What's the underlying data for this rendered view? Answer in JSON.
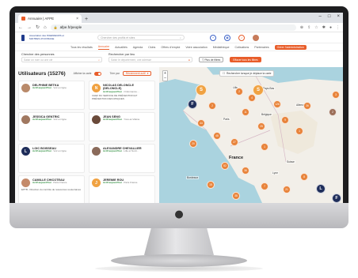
{
  "browser": {
    "tab_title": "Annuaire | AFPE",
    "tab_close": "×",
    "new_tab": "+",
    "win_min": "–",
    "win_max": "□",
    "win_close": "×",
    "url": "afpe.fr/people",
    "lock": "🔒"
  },
  "site": {
    "logo_text": "Association des INGENIEURS et MAITRES d'OUVRAGE",
    "search_placeholder": "Chercher des profils et sites",
    "nav": [
      "Tous les résultats",
      "Annuaire",
      "Actualités",
      "Agenda",
      "Clubs",
      "Offres d'emploi",
      "Votre association",
      "Médiathèque",
      "Cotisations",
      "Partenaires",
      "Gérer l'administration"
    ],
    "active_nav": "Annuaire",
    "admin_nav": "Gérer l'administration"
  },
  "filters": {
    "people_label": "Chercher des personnes",
    "people_placeholder": "Saisir un nom ou une clé",
    "place_label": "Rechercher par lieu",
    "place_placeholder": "Saisir le département, une adresse",
    "more_filters": "Plus de filtres",
    "clear": "Effacer tous les filtres"
  },
  "list": {
    "title": "Utilisateurs (15276)",
    "map_toggle_label": "Afficher la carte",
    "sort_label": "Trier par",
    "sort_value": "Récemment actif",
    "cards": [
      {
        "name": "DELPHINE BETKA",
        "role_status": "Actif aujourd'hui",
        "role_rest": "· Voir en ligne",
        "extra": "",
        "initial": "",
        "color": "#b98a6a"
      },
      {
        "name": "NICOLAS DELONCLE (DELONCLE)",
        "role_status": "Actif aujourd'hui",
        "role_rest": "· Ordonnance…",
        "extra": "CHEF DU SERVICE DE PRÉVENTION ET PRÉVENTION DES RISQUES",
        "initial": "N",
        "color": "#f0a242"
      },
      {
        "name": "JESSICA GENTRIC",
        "role_status": "Actif aujourd'hui",
        "role_rest": "· Voir en ligne",
        "extra": "",
        "initial": "",
        "color": "#a07860"
      },
      {
        "name": "JEAN SENG",
        "role_status": "Actif aujourd'hui",
        "role_rest": "· Yves-et-Vilaine",
        "extra": "",
        "initial": "",
        "color": "#6a4a3a"
      },
      {
        "name": "LOIC BOISSEAU",
        "role_status": "Actif aujourd'hui",
        "role_rest": "· Voir en ligne",
        "extra": "",
        "initial": "L",
        "color": "#1e2d5a"
      },
      {
        "name": "ALEXANDRE CHEVALLIER",
        "role_status": "Actif aujourd'hui",
        "role_rest": "· Lille et Nord…",
        "extra": "",
        "initial": "",
        "color": "#8a6a5a"
      },
      {
        "name": "CAMILLE CHICOTEAU",
        "role_status": "Actif aujourd'hui",
        "role_rest": "· Paris France",
        "extra": "EPTB - Direction du contrôle de ressources souterraines",
        "initial": "",
        "color": "#c48a6a"
      },
      {
        "name": "JEREMIE ROU",
        "role_status": "Actif aujourd'hui",
        "role_rest": "· Paris France",
        "extra": "",
        "initial": "J",
        "color": "#f0a242"
      }
    ]
  },
  "map": {
    "search_toggle": "Rechercher lorsque je déplace la carte",
    "zoom_in": "+",
    "zoom_out": "–",
    "countries": [
      "France",
      "Belgique",
      "Suisse",
      "Allemagne"
    ],
    "cities": [
      "Pays-Bas",
      "Paris",
      "Lyon",
      "Bordeaux",
      "Lille"
    ],
    "clusters": [
      "S",
      "S",
      "F",
      "3",
      "2",
      "4",
      "2",
      "126",
      "36",
      "2",
      "44",
      "11",
      "25",
      "9",
      "1",
      "20",
      "48",
      "27",
      "1",
      "52",
      "36",
      "15",
      "7",
      "38",
      "21",
      "8",
      "L",
      "F"
    ]
  }
}
